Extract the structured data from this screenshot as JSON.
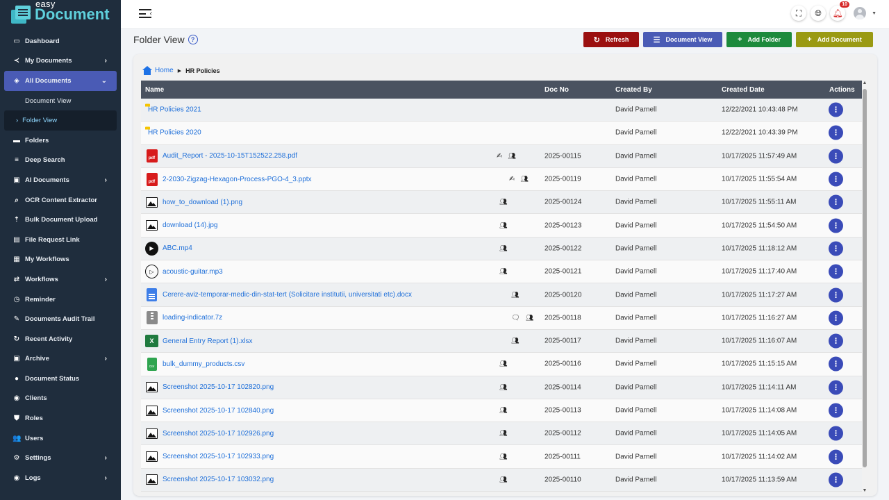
{
  "app": {
    "logo_small": "easy",
    "logo_big": "Document"
  },
  "sidebar": {
    "items": [
      {
        "label": "Dashboard",
        "icon": "▭",
        "arrow": ""
      },
      {
        "label": "My Documents",
        "icon": "≺",
        "arrow": "›"
      },
      {
        "label": "All Documents",
        "icon": "◈",
        "arrow": "⌄"
      },
      {
        "label": "Document View"
      },
      {
        "label": "Folder View"
      },
      {
        "label": "Folders",
        "icon": "▬",
        "arrow": ""
      },
      {
        "label": "Deep Search",
        "icon": "≡",
        "arrow": ""
      },
      {
        "label": "AI Documents",
        "icon": "▣",
        "arrow": "›"
      },
      {
        "label": "OCR Content Extractor",
        "icon": "⌕",
        "arrow": ""
      },
      {
        "label": "Bulk Document Upload",
        "icon": "⇡",
        "arrow": ""
      },
      {
        "label": "File Request Link",
        "icon": "▤",
        "arrow": ""
      },
      {
        "label": "My Workflows",
        "icon": "▦",
        "arrow": ""
      },
      {
        "label": "Workflows",
        "icon": "⇄",
        "arrow": "›"
      },
      {
        "label": "Reminder",
        "icon": "◷",
        "arrow": ""
      },
      {
        "label": "Documents Audit Trail",
        "icon": "✎",
        "arrow": ""
      },
      {
        "label": "Recent Activity",
        "icon": "↻",
        "arrow": ""
      },
      {
        "label": "Archive",
        "icon": "▣",
        "arrow": "›"
      },
      {
        "label": "Document Status",
        "icon": "●",
        "arrow": ""
      },
      {
        "label": "Clients",
        "icon": "◉",
        "arrow": ""
      },
      {
        "label": "Roles",
        "icon": "⛊",
        "arrow": ""
      },
      {
        "label": "Users",
        "icon": "👥",
        "arrow": ""
      },
      {
        "label": "Settings",
        "icon": "⚙",
        "arrow": "›"
      },
      {
        "label": "Logs",
        "icon": "◉",
        "arrow": "›"
      }
    ]
  },
  "topbar": {
    "notification_count": "10"
  },
  "header": {
    "title": "Folder View",
    "help": "?",
    "buttons": {
      "refresh": "Refresh",
      "document_view": "Document View",
      "add_folder": "Add Folder",
      "add_document": "Add Document"
    }
  },
  "breadcrumb": {
    "home": "Home",
    "current": "HR Policies"
  },
  "table": {
    "columns": {
      "name": "Name",
      "doc_no": "Doc No",
      "created_by": "Created By",
      "created_date": "Created Date",
      "actions": "Actions"
    },
    "rows": [
      {
        "type": "folder",
        "name": "HR Policies 2021",
        "doc_no": "",
        "created_by": "David Parnell",
        "created_date": "12/22/2021 10:43:48 PM",
        "flags": ""
      },
      {
        "type": "folder",
        "name": "HR Policies 2020",
        "doc_no": "",
        "created_by": "David Parnell",
        "created_date": "12/22/2021 10:43:39 PM",
        "flags": ""
      },
      {
        "type": "pdf",
        "name": "Audit_Report - 2025-10-15T152522.258.pdf",
        "doc_no": "2025-00115",
        "created_by": "David Parnell",
        "created_date": "10/17/2025 11:57:49 AM",
        "flags": "sign-shared"
      },
      {
        "type": "pdf",
        "name": "2-2030-Zigzag-Hexagon-Process-PGO-4_3.pptx",
        "doc_no": "2025-00119",
        "created_by": "David Parnell",
        "created_date": "10/17/2025 11:55:54 AM",
        "flags": "sign-shared"
      },
      {
        "type": "image",
        "name": "how_to_download (1).png",
        "doc_no": "2025-00124",
        "created_by": "David Parnell",
        "created_date": "10/17/2025 11:55:11 AM",
        "flags": "shared"
      },
      {
        "type": "image",
        "name": "download (14).jpg",
        "doc_no": "2025-00123",
        "created_by": "David Parnell",
        "created_date": "10/17/2025 11:54:50 AM",
        "flags": "shared"
      },
      {
        "type": "video",
        "name": "ABC.mp4",
        "doc_no": "2025-00122",
        "created_by": "David Parnell",
        "created_date": "10/17/2025 11:18:12 AM",
        "flags": "shared"
      },
      {
        "type": "audio",
        "name": "acoustic-guitar.mp3",
        "doc_no": "2025-00121",
        "created_by": "David Parnell",
        "created_date": "10/17/2025 11:17:40 AM",
        "flags": "shared"
      },
      {
        "type": "doc",
        "name": "Cerere-aviz-temporar-medic-din-stat-tert (Solicitare institutii, universitati etc).docx",
        "doc_no": "2025-00120",
        "created_by": "David Parnell",
        "created_date": "10/17/2025 11:17:27 AM",
        "flags": "shared"
      },
      {
        "type": "zip",
        "name": "loading-indicator.7z",
        "doc_no": "2025-00118",
        "created_by": "David Parnell",
        "created_date": "10/17/2025 11:16:27 AM",
        "flags": "comment-shared"
      },
      {
        "type": "xls",
        "name": "General Entry Report (1).xlsx",
        "doc_no": "2025-00117",
        "created_by": "David Parnell",
        "created_date": "10/17/2025 11:16:07 AM",
        "flags": "shared"
      },
      {
        "type": "csv",
        "name": "bulk_dummy_products.csv",
        "doc_no": "2025-00116",
        "created_by": "David Parnell",
        "created_date": "10/17/2025 11:15:15 AM",
        "flags": "shared"
      },
      {
        "type": "image",
        "name": "Screenshot 2025-10-17 102820.png",
        "doc_no": "2025-00114",
        "created_by": "David Parnell",
        "created_date": "10/17/2025 11:14:11 AM",
        "flags": "shared"
      },
      {
        "type": "image",
        "name": "Screenshot 2025-10-17 102840.png",
        "doc_no": "2025-00113",
        "created_by": "David Parnell",
        "created_date": "10/17/2025 11:14:08 AM",
        "flags": "shared"
      },
      {
        "type": "image",
        "name": "Screenshot 2025-10-17 102926.png",
        "doc_no": "2025-00112",
        "created_by": "David Parnell",
        "created_date": "10/17/2025 11:14:05 AM",
        "flags": "shared"
      },
      {
        "type": "image",
        "name": "Screenshot 2025-10-17 102933.png",
        "doc_no": "2025-00111",
        "created_by": "David Parnell",
        "created_date": "10/17/2025 11:14:02 AM",
        "flags": "shared"
      },
      {
        "type": "image",
        "name": "Screenshot 2025-10-17 103032.png",
        "doc_no": "2025-00110",
        "created_by": "David Parnell",
        "created_date": "10/17/2025 11:13:59 AM",
        "flags": "shared"
      }
    ]
  },
  "colors": {
    "sidebar_bg": "#1f2d3d",
    "accent": "#4a5bb5",
    "link": "#1e6fd9",
    "refresh": "#9b1010",
    "add_folder": "#1d8a3c",
    "add_document": "#9a9a13"
  }
}
